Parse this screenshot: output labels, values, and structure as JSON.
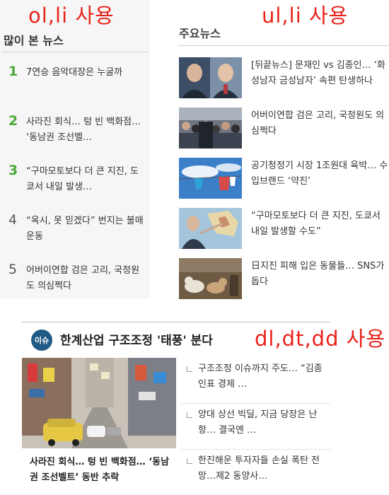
{
  "annotations": {
    "ol_li": "ol,li 사용",
    "ul_li": "ul,li 사용",
    "dl_dt_dd": "dl,dt,dd 사용"
  },
  "popular": {
    "title": "많이 본 뉴스",
    "items": [
      {
        "rank": "1",
        "text": "7연승 음악대장은 누굴까"
      },
      {
        "rank": "2",
        "text": "사라진 회식… 텅 빈 백화점… ‘동남권 조선벨…"
      },
      {
        "rank": "3",
        "text": "“구마모토보다 더 큰 지진, 도쿄서 내일 발생…"
      },
      {
        "rank": "4",
        "text": "“옥시, 못 믿겠다” 번지는 불매운동"
      },
      {
        "rank": "5",
        "text": "어버이연합 검은 고리, 국정원도 의심쩍다"
      }
    ]
  },
  "main_news": {
    "title": "주요뉴스",
    "items": [
      {
        "text": "[뒤끝뉴스] 문재인 vs 김종인… ‘화성남자 금성남자’ 속편 탄생하나",
        "thumb": "two-men-photo"
      },
      {
        "text": "어버이연합 검은 고리, 국정원도 의심쩍다",
        "thumb": "crowd-photo"
      },
      {
        "text": "공기청정기 시장 1조원대 육박… 수입브랜드 ‘약진’",
        "thumb": "sky-laundry-photo"
      },
      {
        "text": "“구마모토보다 더 큰 지진, 도쿄서 내일 발생할 수도”",
        "thumb": "map-man-photo"
      },
      {
        "text": "日지진 피해 입은 동물들… SNS가 돕다",
        "thumb": "dogs-photo"
      }
    ]
  },
  "issue": {
    "badge": "이슈",
    "heading": "한계산업 구조조정 '태풍' 분다",
    "photo_caption": "사라진 회식… 텅 빈 백화점… ‘동남권 조선벨트’ 동반 추락",
    "links": [
      {
        "text": "구조조정 이슈까지 주도… “김종인표 경제 …"
      },
      {
        "text": "양대 상선 빅딜, 지금 당장은 난항… 결국엔 …"
      },
      {
        "text": "한진해운 투자자들 손실 폭탄 전망…제2 동양사…"
      }
    ]
  },
  "colors": {
    "annotation": "#e8231a",
    "rank_top": "#4aa838",
    "badge": "#1e5a84"
  }
}
